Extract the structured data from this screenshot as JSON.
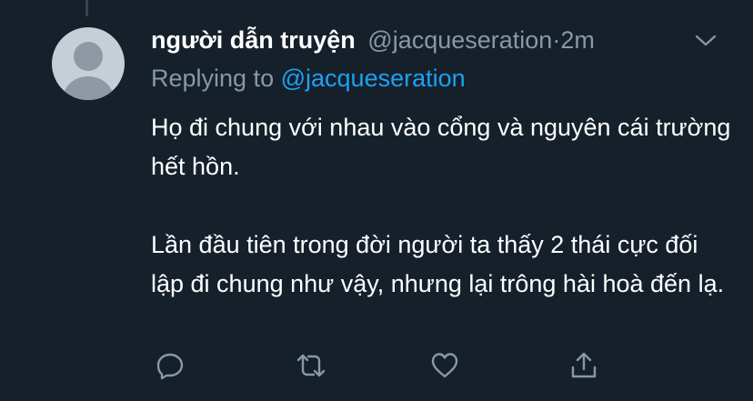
{
  "tweet": {
    "author": {
      "display_name": "người dẫn truyện",
      "handle": "@jacqueseration",
      "avatar": "default-avatar-icon"
    },
    "separator": "·",
    "time": "2m",
    "reply": {
      "prefix": "Replying to",
      "handle": "@jacqueseration"
    },
    "paragraphs": [
      "Họ đi chung với nhau vào cổng và nguyên cái trường hết hồn.",
      "Lần đầu tiên trong đời người ta thấy 2 thái cực đối lập đi chung như vậy, nhưng lại trông hài hoà đến lạ."
    ],
    "actions": [
      "reply-icon",
      "retweet-icon",
      "like-icon",
      "share-icon"
    ]
  },
  "colors": {
    "background": "#15202b",
    "primary_text": "#ffffff",
    "secondary_text": "#8899a6",
    "accent": "#1da1f2"
  }
}
